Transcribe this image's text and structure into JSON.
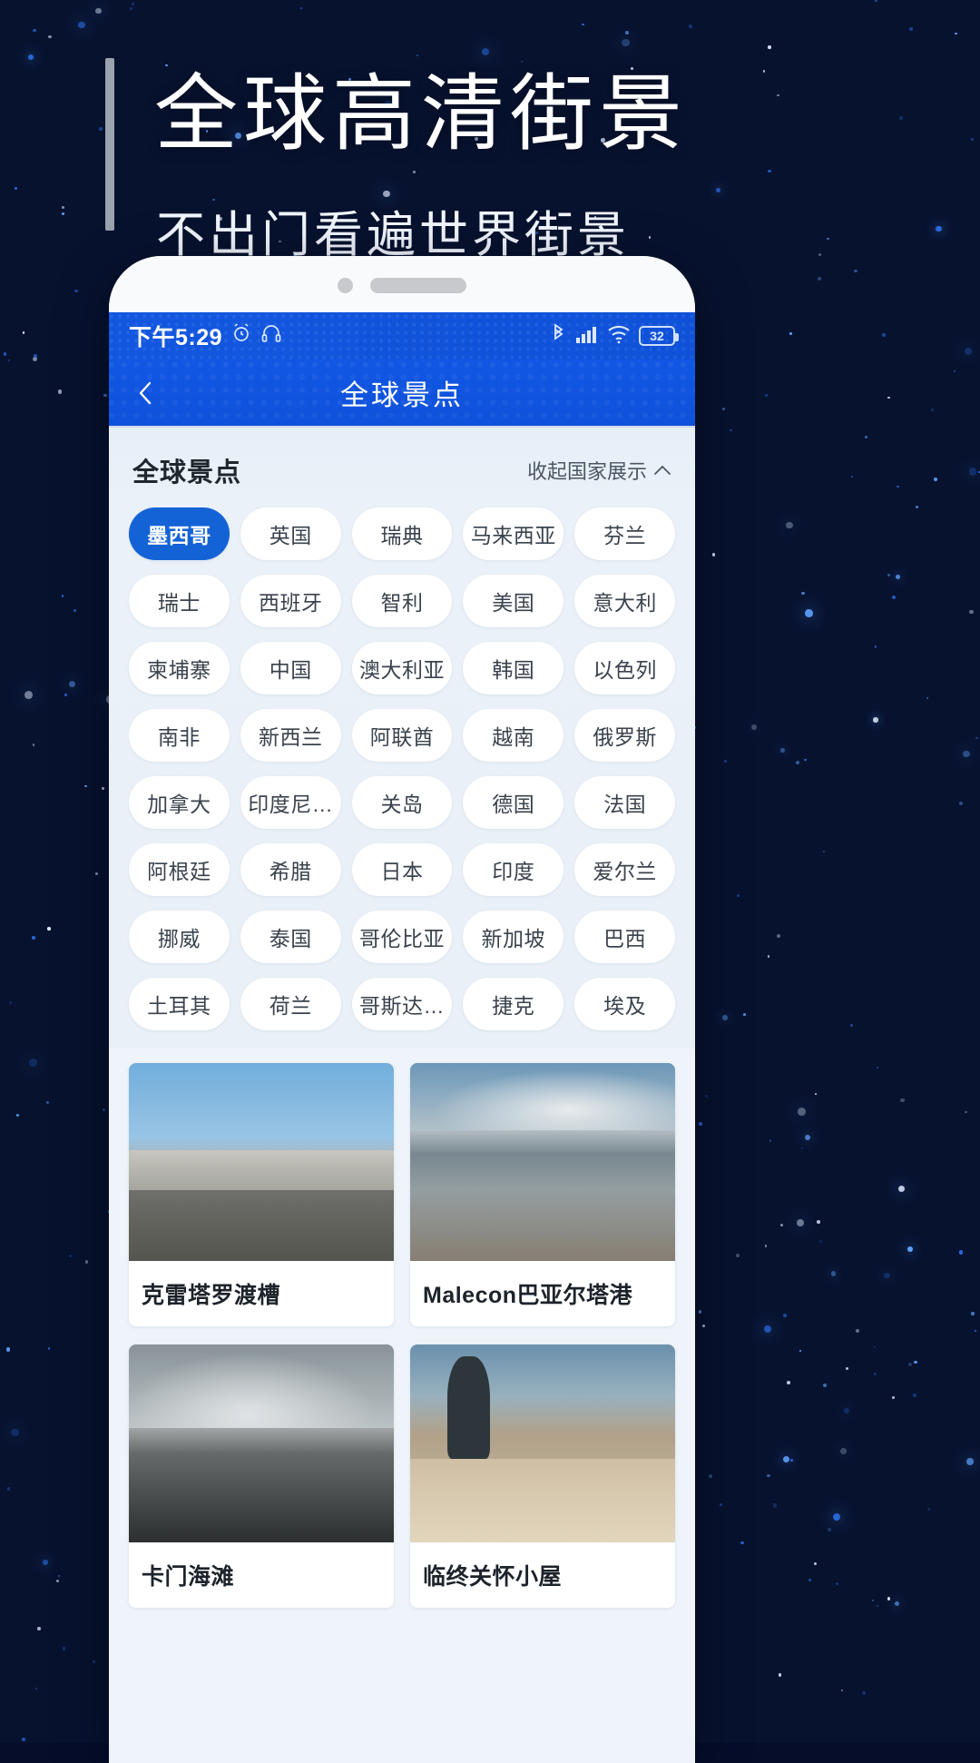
{
  "promo": {
    "headline": "全球高清街景",
    "subhead": "不出门看遍世界街景"
  },
  "phone": {
    "statusbar": {
      "time": "下午5:29",
      "alarm_icon": "alarm-clock-icon",
      "headphone_icon": "headphone-icon",
      "bluetooth_icon": "bluetooth-icon",
      "signal_icon": "signal-bars-icon",
      "wifi_icon": "wifi-icon",
      "battery_level": "32"
    },
    "navbar": {
      "back_icon": "back-chevron-icon",
      "title": "全球景点"
    },
    "section": {
      "title": "全球景点",
      "action_label": "收起国家展示",
      "action_icon": "chevron-up-icon"
    },
    "countries": [
      {
        "label": "墨西哥",
        "selected": true
      },
      {
        "label": "英国",
        "selected": false
      },
      {
        "label": "瑞典",
        "selected": false
      },
      {
        "label": "马来西亚",
        "selected": false
      },
      {
        "label": "芬兰",
        "selected": false
      },
      {
        "label": "瑞士",
        "selected": false
      },
      {
        "label": "西班牙",
        "selected": false
      },
      {
        "label": "智利",
        "selected": false
      },
      {
        "label": "美国",
        "selected": false
      },
      {
        "label": "意大利",
        "selected": false
      },
      {
        "label": "柬埔寨",
        "selected": false
      },
      {
        "label": "中国",
        "selected": false
      },
      {
        "label": "澳大利亚",
        "selected": false
      },
      {
        "label": "韩国",
        "selected": false
      },
      {
        "label": "以色列",
        "selected": false
      },
      {
        "label": "南非",
        "selected": false
      },
      {
        "label": "新西兰",
        "selected": false
      },
      {
        "label": "阿联酋",
        "selected": false
      },
      {
        "label": "越南",
        "selected": false
      },
      {
        "label": "俄罗斯",
        "selected": false
      },
      {
        "label": "加拿大",
        "selected": false
      },
      {
        "label": "印度尼…",
        "selected": false
      },
      {
        "label": "关岛",
        "selected": false
      },
      {
        "label": "德国",
        "selected": false
      },
      {
        "label": "法国",
        "selected": false
      },
      {
        "label": "阿根廷",
        "selected": false
      },
      {
        "label": "希腊",
        "selected": false
      },
      {
        "label": "日本",
        "selected": false
      },
      {
        "label": "印度",
        "selected": false
      },
      {
        "label": "爱尔兰",
        "selected": false
      },
      {
        "label": "挪威",
        "selected": false
      },
      {
        "label": "泰国",
        "selected": false
      },
      {
        "label": "哥伦比亚",
        "selected": false
      },
      {
        "label": "新加坡",
        "selected": false
      },
      {
        "label": "巴西",
        "selected": false
      },
      {
        "label": "土耳其",
        "selected": false
      },
      {
        "label": "荷兰",
        "selected": false
      },
      {
        "label": "哥斯达…",
        "selected": false
      },
      {
        "label": "捷克",
        "selected": false
      },
      {
        "label": "埃及",
        "selected": false
      }
    ],
    "spots": [
      {
        "title": "克雷塔罗渡槽",
        "thumb": "aqueduct-photo"
      },
      {
        "title": "Malecon巴亚尔塔港",
        "thumb": "beach-photo"
      },
      {
        "title": "卡门海滩",
        "thumb": "volcano-photo"
      },
      {
        "title": "临终关怀小屋",
        "thumb": "statue-beach-photo"
      }
    ]
  },
  "colors": {
    "brand_blue": "#1157e4",
    "chip_selected": "#1463d6",
    "screen_bg": "#eef4fa",
    "night_bg": "#07122f"
  }
}
